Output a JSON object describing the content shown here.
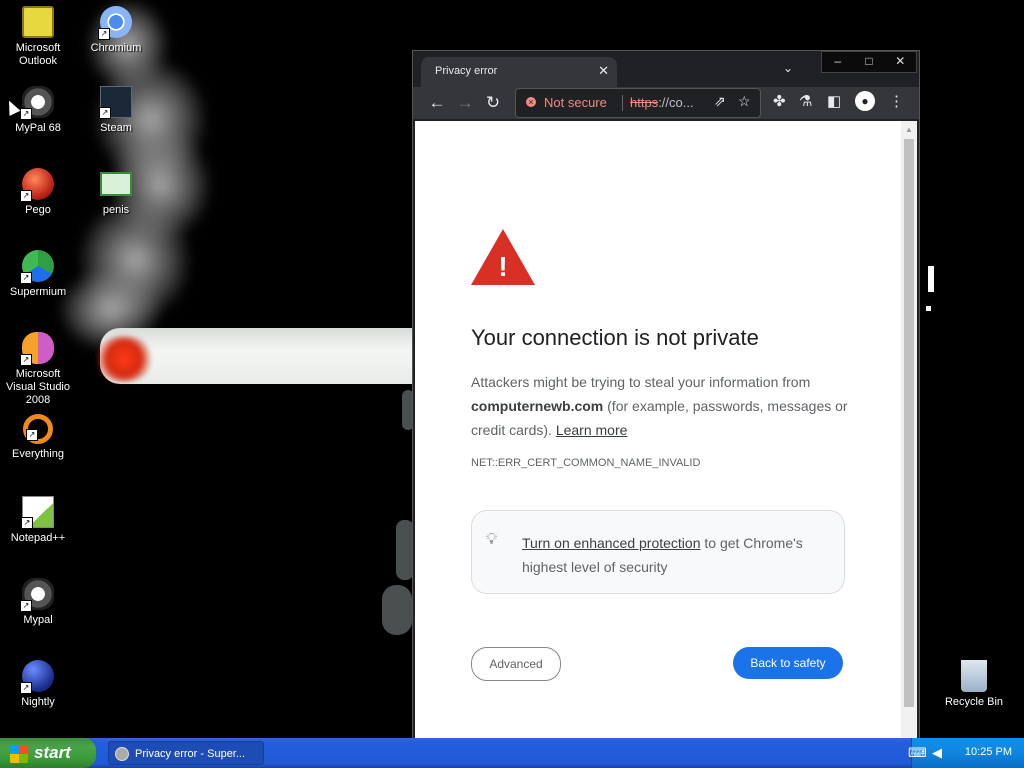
{
  "desktop": {
    "icons_left": [
      {
        "label": "Microsoft Outlook",
        "icon": "outlook-icon"
      },
      {
        "label": "MyPal 68",
        "icon": "mypal-icon"
      },
      {
        "label": "Pego",
        "icon": "pego-icon"
      },
      {
        "label": "Supermium",
        "icon": "supermium-icon"
      },
      {
        "label": "Microsoft Visual Studio 2008",
        "icon": "visual-studio-icon"
      },
      {
        "label": "Everything",
        "icon": "everything-icon"
      },
      {
        "label": "Notepad++",
        "icon": "notepadpp-icon"
      },
      {
        "label": "Mypal",
        "icon": "mypal-icon"
      },
      {
        "label": "Nightly",
        "icon": "nightly-icon"
      }
    ],
    "icons_col2": [
      {
        "label": "Chromium",
        "icon": "chromium-icon"
      },
      {
        "label": "Steam",
        "icon": "steam-icon"
      },
      {
        "label": "penis",
        "icon": "image-file-icon"
      }
    ],
    "recycle_bin": {
      "label": "Recycle Bin",
      "icon": "recycle-bin-icon"
    }
  },
  "browser": {
    "tab_title": "Privacy error",
    "address": {
      "security_label": "Not secure",
      "url_scheme": "https",
      "url_rest": "://co..."
    },
    "page": {
      "heading": "Your connection is not private",
      "desc_part1": "Attackers might be trying to steal your information from",
      "domain": "computernewb.com",
      "desc_part2": "(for example, passwords, messages or credit cards).",
      "learn_more": "Learn more",
      "error_code": "NET::ERR_CERT_COMMON_NAME_INVALID",
      "enhanced_link": "Turn on enhanced protection",
      "enhanced_rest": "to get Chrome's highest level of security",
      "advanced_button": "Advanced",
      "back_button": "Back to safety"
    },
    "colors": {
      "primary_button": "#1a73e8",
      "warning": "#d93025",
      "not_secure": "#f28b82"
    }
  },
  "taskbar": {
    "start_label": "start",
    "task_label": "Privacy error - Super...",
    "clock": "10:25 PM"
  }
}
